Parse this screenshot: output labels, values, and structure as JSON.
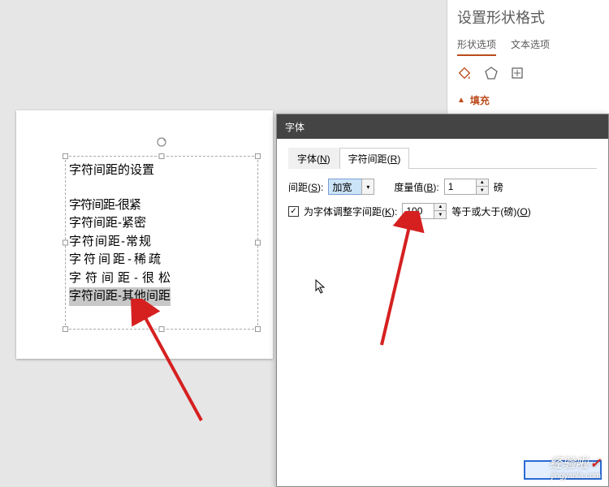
{
  "sidebar": {
    "title": "设置形状格式",
    "tabs": {
      "shape": "形状选项",
      "text": "文本选项"
    },
    "fill_label": "填充"
  },
  "textbox": {
    "title": "字符间距的设置",
    "lines": {
      "l1": "字符间距-很紧",
      "l2": "字符间距-紧密",
      "l3": "字符间距-常规",
      "l4": "字符间距-稀疏",
      "l5": "字符间距-很松",
      "l6": "字符间距-其他间距"
    }
  },
  "dialog": {
    "title": "字体",
    "tab_font": "字体(",
    "tab_font_hk": "N",
    "tab_font_end": ")",
    "tab_spacing": "字符间距(",
    "tab_spacing_hk": "R",
    "tab_spacing_end": ")",
    "spacing_label": "间距(",
    "spacing_hk": "S",
    "spacing_end": "):",
    "spacing_value": "加宽",
    "amount_label": "度量值(",
    "amount_hk": "B",
    "amount_end": "):",
    "amount_value": "1",
    "amount_unit": "磅",
    "kern_label": "为字体调整字间距(",
    "kern_hk": "K",
    "kern_end": "):",
    "kern_value": "100",
    "kern_suffix": "等于或大于(磅)(",
    "kern_suffix_hk": "O",
    "kern_suffix_end": ")"
  },
  "watermark": {
    "main": "经验啦",
    "sub": "jingyanla.com"
  }
}
